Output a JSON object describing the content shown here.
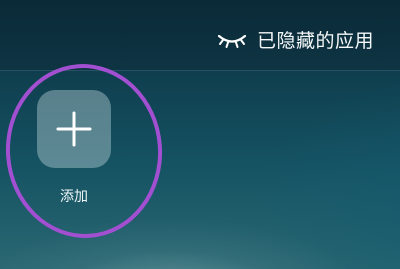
{
  "header": {
    "hidden_apps_label": "已隐藏的应用",
    "icon": "closed-eye-icon"
  },
  "grid": {
    "add_tile": {
      "label": "添加",
      "icon": "plus-icon"
    }
  },
  "annotation": {
    "highlight_color": "#a24fd2"
  },
  "colors": {
    "background_top": "#0c2f3e",
    "background_bottom": "#2a6873",
    "tile": "#bed7dc",
    "text": "#ffffff"
  }
}
